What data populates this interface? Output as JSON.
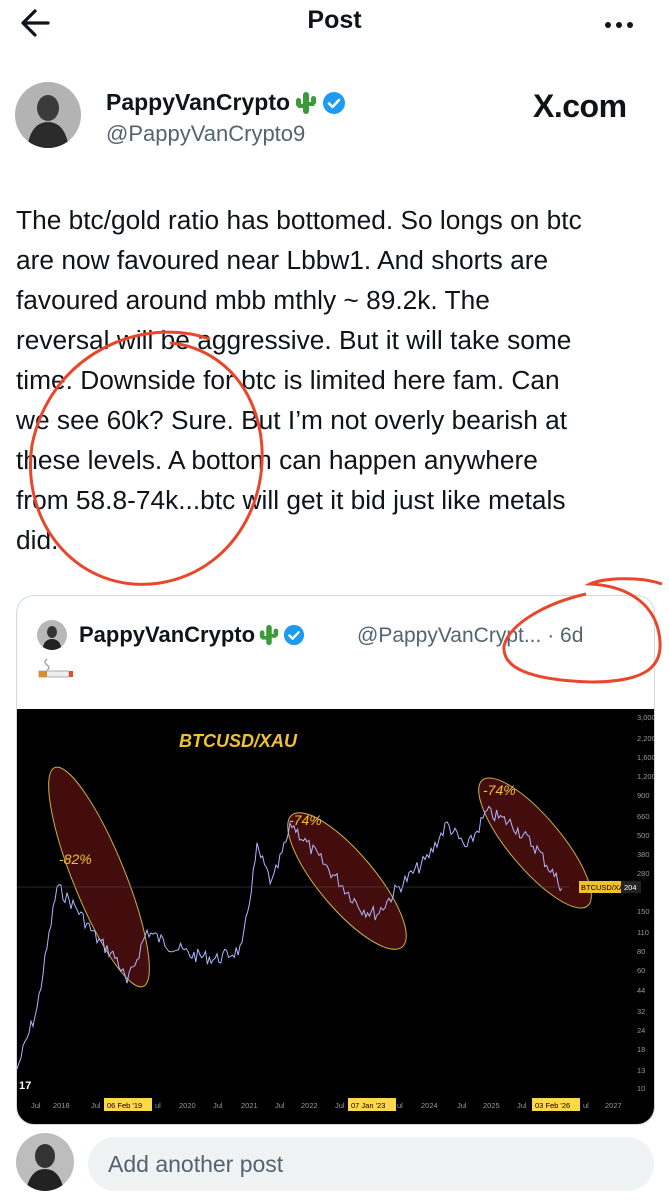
{
  "header": {
    "title": "Post"
  },
  "author": {
    "name": "PappyVanCrypto",
    "handle": "@PappyVanCrypto9",
    "badge": "verified-badge-icon",
    "name_emoji": "cactus-icon"
  },
  "watermark": "X.com",
  "post": {
    "lines": [
      "The btc/gold ratio has bottomed. So longs on btc",
      "are now favoured near Lbbw1. And shorts are",
      "favoured around mbb mthly ~ 89.2k. The",
      "reversal will be aggressive. But it will take some",
      "time. Downside for btc is limited here fam. Can",
      "we see 60k? Sure. But I’m not overly bearish at",
      "these levels. A bottom can happen anywhere",
      "from 58.8-74k...btc will get it bid just like metals",
      "did."
    ]
  },
  "quote": {
    "name": "PappyVanCrypto",
    "handle": "@PappyVanCrypt...",
    "time": "· 6d",
    "emoji": "cigarette-icon"
  },
  "chart_data": {
    "type": "line",
    "title": "BTCUSD/XAU",
    "y_ticks": [
      "3,000",
      "2,200",
      "1,600",
      "1,200",
      "900",
      "660",
      "500",
      "380",
      "280",
      "204",
      "150",
      "110",
      "80",
      "60",
      "44",
      "32",
      "24",
      "18",
      "13",
      "10"
    ],
    "x_ticks": [
      "Jul",
      "2018",
      "Jul",
      "06 Feb '19",
      "ul",
      "2020",
      "Jul",
      "2021",
      "Jul",
      "2022",
      "Jul",
      "07 Jan '23",
      "ul",
      "2024",
      "Jul",
      "2025",
      "Jul",
      "03 Feb '26",
      "ul",
      "2027"
    ],
    "annotations": [
      "-82%",
      "-74%",
      "-74%"
    ],
    "price_label": "BTCUSD/XAU",
    "price_value": "204",
    "y_scale": "log",
    "colors": {
      "background": "#000000",
      "title": "#f2c12e",
      "highlight": "#ffd84a",
      "ellipse_fill": "#5a1212",
      "ellipse_stroke": "#c9b24a"
    }
  },
  "reply": {
    "placeholder": "Add another post"
  },
  "colors": {
    "accent": "#1d9bf0",
    "muted": "#536471",
    "markup": "#e8472c"
  }
}
